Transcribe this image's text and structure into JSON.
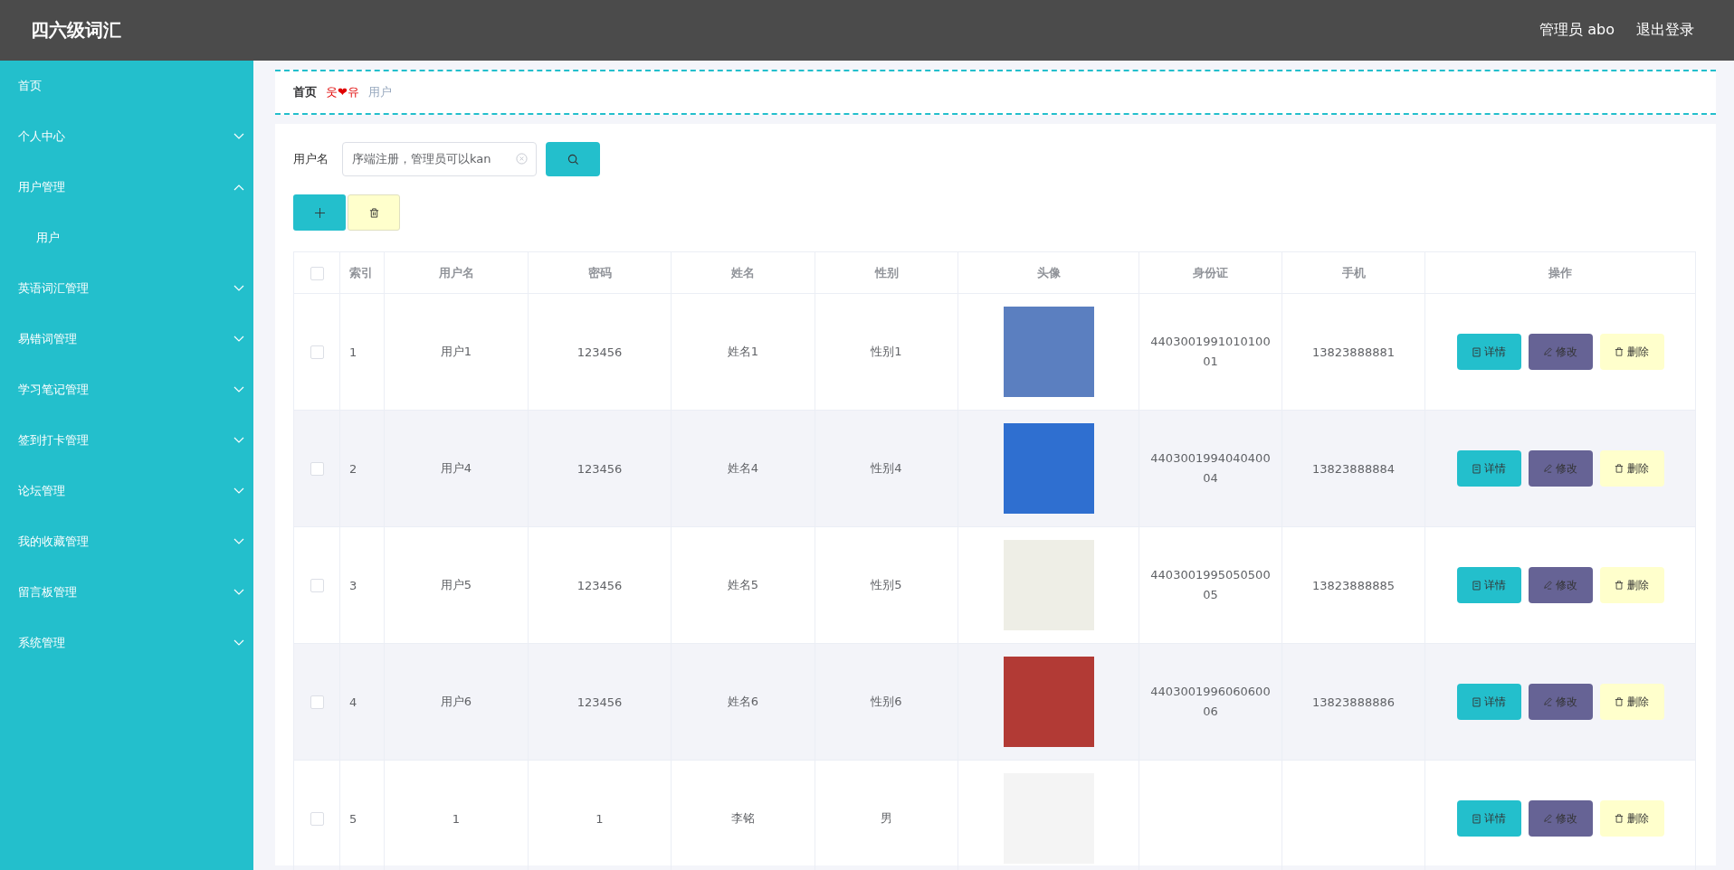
{
  "header": {
    "title": "四六级词汇",
    "user": "管理员 abo",
    "logout": "退出登录"
  },
  "sidebar": {
    "items": [
      {
        "label": "首页"
      },
      {
        "label": "个人中心",
        "expanded": false
      },
      {
        "label": "用户管理",
        "expanded": true,
        "children": [
          {
            "label": "用户"
          }
        ]
      },
      {
        "label": "英语词汇管理",
        "expanded": false
      },
      {
        "label": "易错词管理",
        "expanded": false
      },
      {
        "label": "学习笔记管理",
        "expanded": false
      },
      {
        "label": "签到打卡管理",
        "expanded": false
      },
      {
        "label": "论坛管理",
        "expanded": false
      },
      {
        "label": "我的收藏管理",
        "expanded": false
      },
      {
        "label": "留言板管理",
        "expanded": false
      },
      {
        "label": "系统管理",
        "expanded": false
      }
    ]
  },
  "breadcrumb": {
    "home": "首页",
    "separator": "웃❤유",
    "current": "用户"
  },
  "search": {
    "label": "用户名",
    "value": "序端注册，管理员可以kan"
  },
  "table": {
    "select_all_checked": false,
    "columns": [
      "索引",
      "用户名",
      "密码",
      "姓名",
      "性别",
      "头像",
      "身份证",
      "手机",
      "操作"
    ],
    "rows": [
      {
        "checked": false,
        "index": "1",
        "username": "用户1",
        "password": "123456",
        "name": "姓名1",
        "gender": "性别1",
        "id_card": "440300199101010001",
        "phone": "13823888881",
        "actions": [
          "详情",
          "修改",
          "删除"
        ]
      },
      {
        "checked": false,
        "index": "2",
        "username": "用户4",
        "password": "123456",
        "name": "姓名4",
        "gender": "性别4",
        "id_card": "440300199404040004",
        "phone": "13823888884",
        "actions": [
          "详情",
          "修改",
          "删除"
        ]
      },
      {
        "checked": false,
        "index": "3",
        "username": "用户5",
        "password": "123456",
        "name": "姓名5",
        "gender": "性别5",
        "id_card": "440300199505050005",
        "phone": "13823888885",
        "actions": [
          "详情",
          "修改",
          "删除"
        ]
      },
      {
        "checked": false,
        "index": "4",
        "username": "用户6",
        "password": "123456",
        "name": "姓名6",
        "gender": "性别6",
        "id_card": "440300199606060006",
        "phone": "13823888886",
        "actions": [
          "详情",
          "修改",
          "删除"
        ]
      },
      {
        "checked": false,
        "index": "5",
        "username": "1",
        "password": "1",
        "name": "李铭",
        "gender": "男",
        "actions": [
          "详情",
          "修改",
          "删除"
        ]
      }
    ]
  }
}
